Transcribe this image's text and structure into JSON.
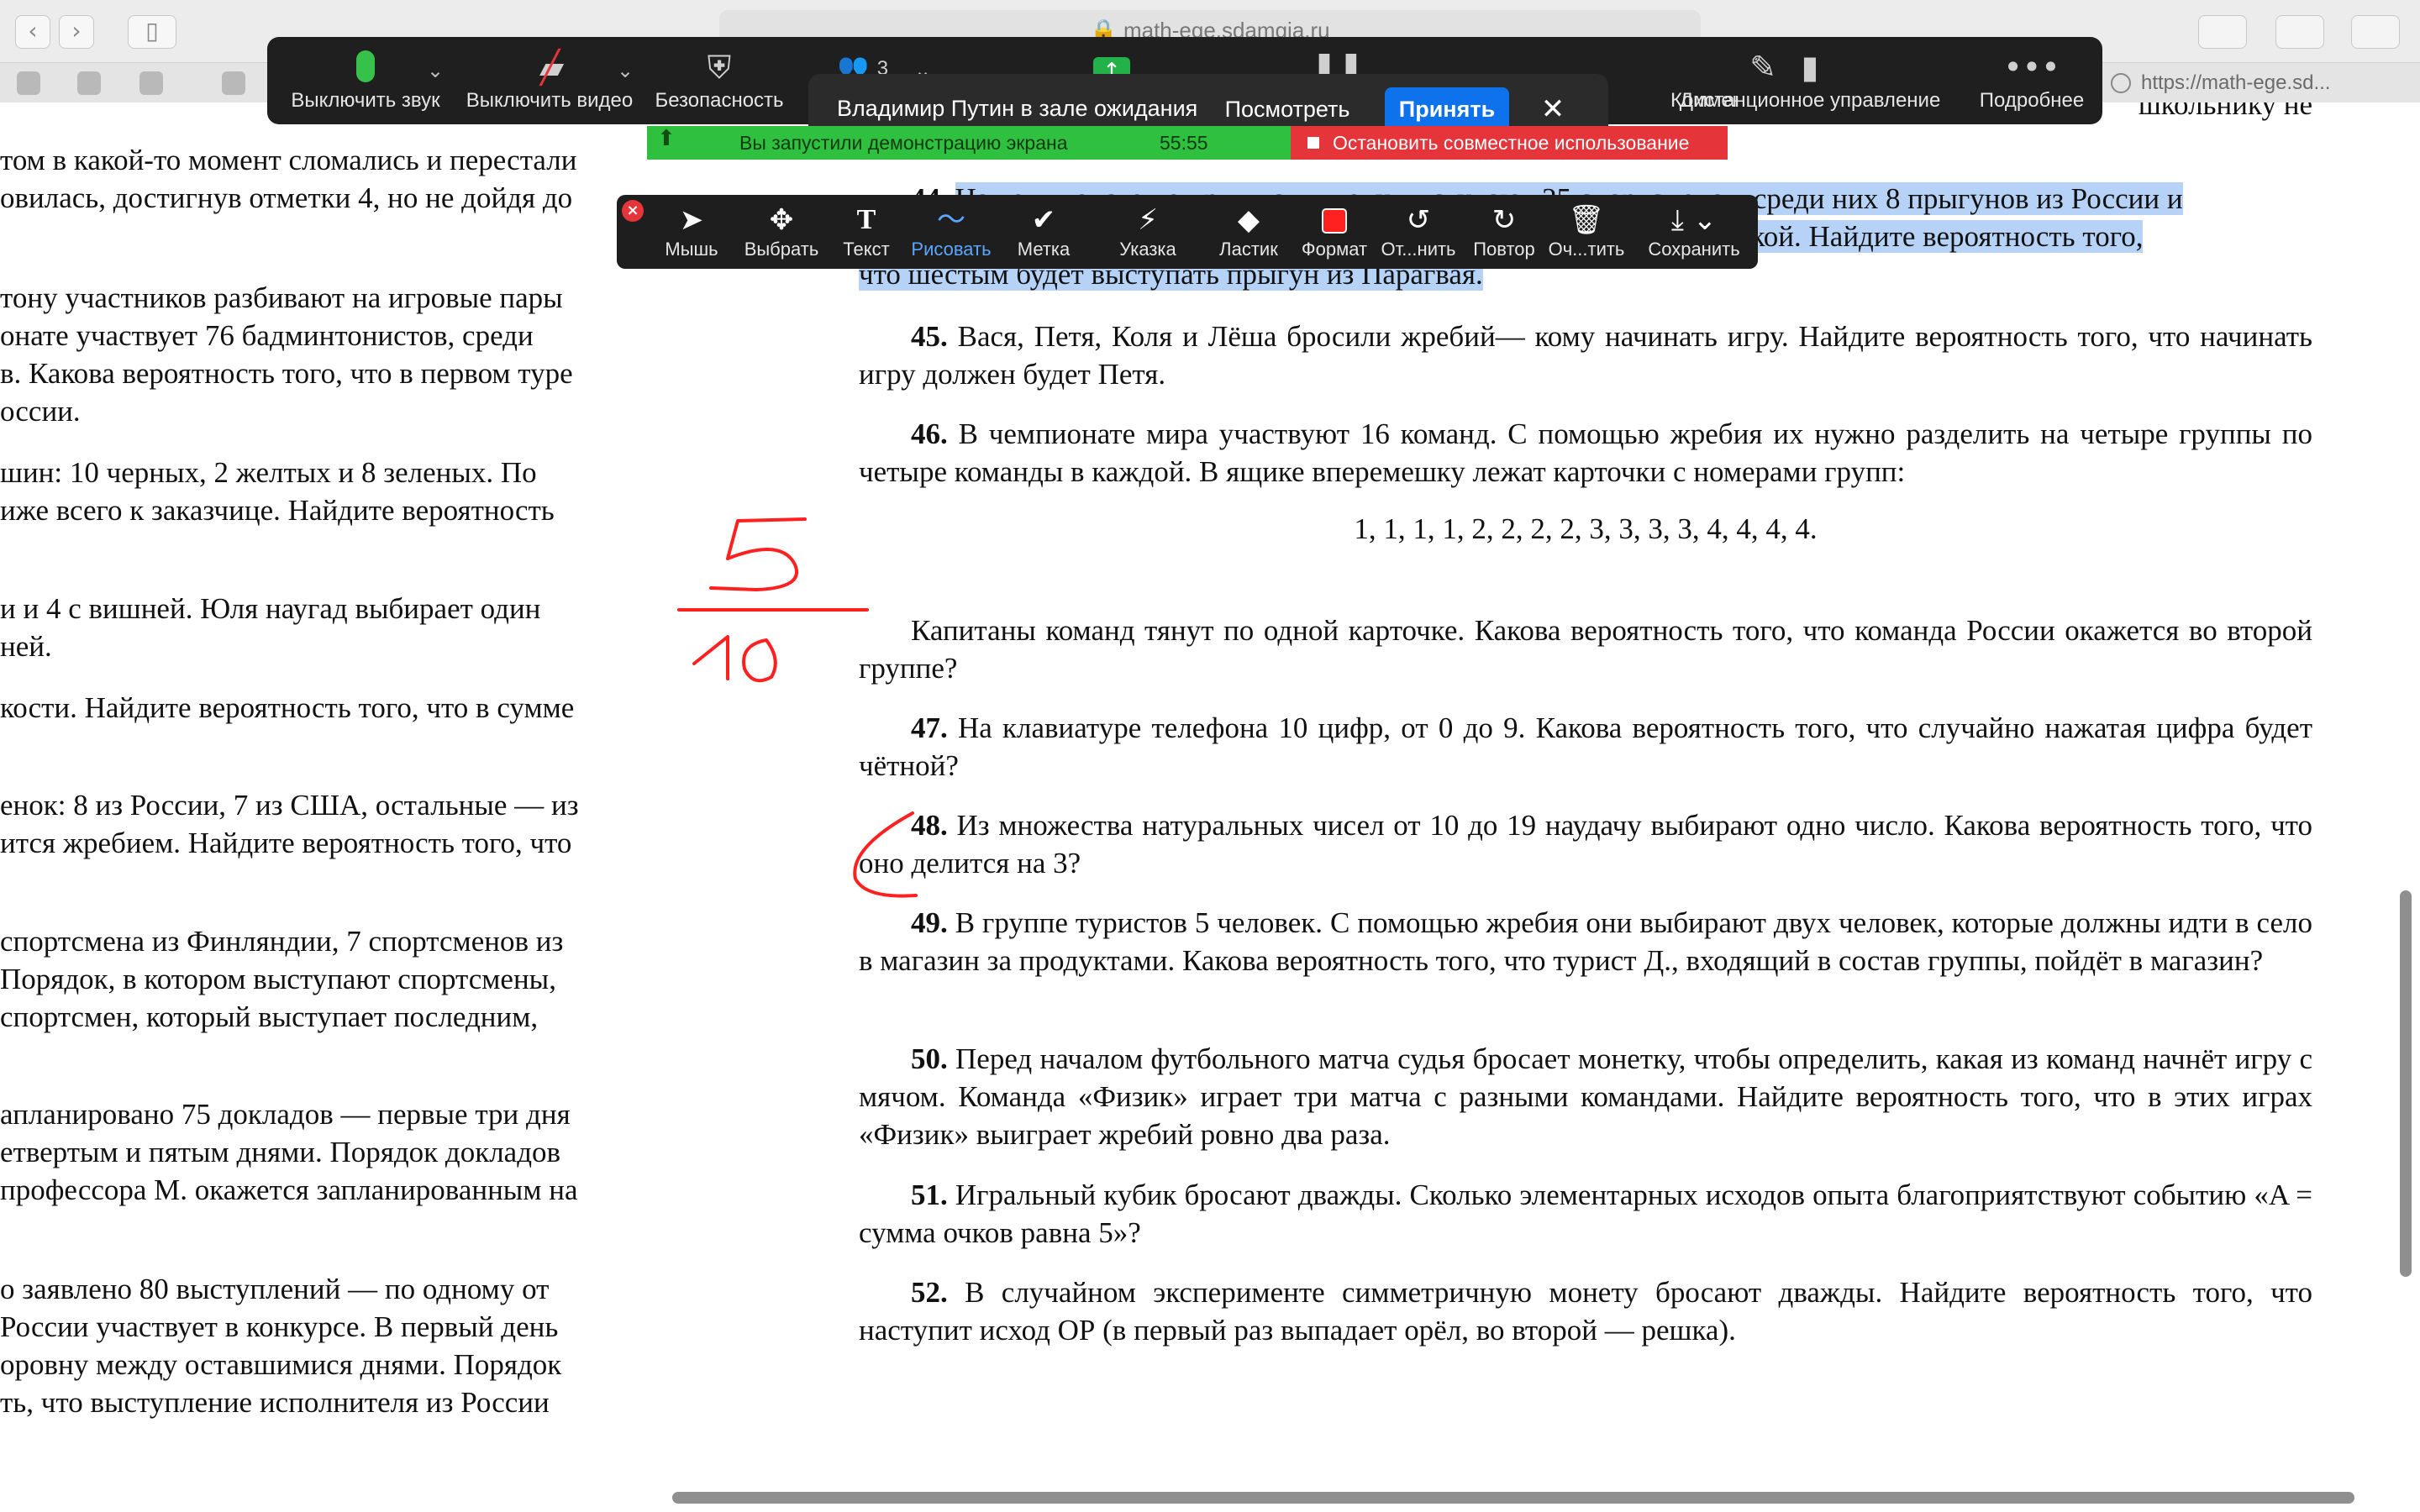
{
  "browser": {
    "url": "math-ege.sdamgia.ru",
    "right_tab": "https://math-ege.sd..."
  },
  "zoom_toolbar": {
    "items": [
      {
        "label": "Выключить звук",
        "icon": "microphone-icon"
      },
      {
        "label": "Выключить видео",
        "icon": "video-off-icon"
      },
      {
        "label": "Безопасность",
        "icon": "shield-icon"
      },
      {
        "label": "3",
        "icon": "participants-icon"
      },
      {
        "label": "Демонстрация",
        "icon": "share-screen-icon"
      },
      {
        "label": "Пауза",
        "icon": "pause-icon"
      },
      {
        "label": "Комментировать",
        "icon": "pencil-icon"
      },
      {
        "label": "Дистанционное управление",
        "icon": "mouse-icon"
      },
      {
        "label": "Подробнее",
        "icon": "more-icon"
      }
    ],
    "participant_count": "3"
  },
  "waiting_room": {
    "message": "Владимир Путин в зале ожидания",
    "view_label": "Посмотреть",
    "accept_label": "Принять"
  },
  "share_status": {
    "message": "Вы запустили демонстрацию экрана",
    "timer": "55:55",
    "stop_label": "Остановить совместное использование"
  },
  "annotation_toolbar": {
    "items": [
      "Мышь",
      "Выбрать",
      "Текст",
      "Рисовать",
      "Метка",
      "Указка",
      "Ластик",
      "Формат",
      "От...нить",
      "Повтор",
      "Оч...тить",
      "Сохранить"
    ],
    "active": "Рисовать",
    "draw_color": "#ff2020"
  },
  "left_column": [
    "том в какой-то момент сломались и перестали",
    "овилась, достигнув отметки 4, но не дойдя до",
    "тону участников разбивают на игровые пары",
    "онате участвует 76 бадминтонистов, среди",
    "в. Какова вероятность того, что в первом туре",
    "оссии.",
    "шин: 10 черных, 2 желтых и 8 зеленых. По",
    "иже всего к заказчице. Найдите вероятность",
    "и и 4 с вишней. Юля наугад выбирает один",
    "ней.",
    "кости. Найдите вероятность того, что в сумме",
    "енок: 8 из России, 7 из США, остальные — из",
    "ится жребием. Найдите вероятность того, что",
    "спортсмена из Финляндии, 7 спортсменов из",
    "Порядок, в котором выступают спортсмены,",
    "спортсмен, который выступает последним,",
    "апланировано 75 докладов — первые три дня",
    "етвертым и пятым днями. Порядок докладов",
    "профессора М. окажется запланированным на",
    "о заявлено 80 выступлений — по одному от",
    "России участвует в конкурсе. В первый день",
    "оровну между оставшимися днями. Порядок",
    "ть, что выступление исполнителя из России"
  ],
  "right_column": {
    "top_partial": "школьнику не",
    "task44": {
      "num": "44.",
      "line1": "На чемпионате по прыжкам в воду выступают 25 спортсменов, среди них 8 прыгунов из России и",
      "line2": "9 прыгунов из Парагвая. Порядок выступлений определяется жеребьёвкой. Найдите вероятность того,",
      "line3": "что шестым будет выступать прыгун из Парагвая."
    },
    "tasks": [
      {
        "num": "45.",
        "text": "Вася, Петя, Коля и Лёша бросили жребий— кому начинать игру. Найдите вероятность того, что начинать игру должен будет Петя."
      },
      {
        "num": "46.",
        "text": "В чемпионате мира участвуют 16 команд. С помощью жребия их нужно разделить на четыре группы по четыре команды в каждой. В ящике вперемешку лежат карточки с номерами групп:"
      },
      {
        "num": "",
        "text": "Капитаны команд тянут по одной карточке. Какова вероятность того, что команда России окажется во второй группе?"
      },
      {
        "num": "47.",
        "text": "На клавиатуре телефона 10 цифр, от 0 до 9. Какова вероятность того, что случайно нажатая цифра будет чётной?"
      },
      {
        "num": "48.",
        "text": "Из множества натуральных чисел от 10 до 19 наудачу выбирают одно число. Какова вероятность того, что оно делится на 3?"
      },
      {
        "num": "49.",
        "text": "В группе туристов 5 человек. С помощью жребия они выбирают двух человек, которые должны идти в село в магазин за продуктами. Какова вероятность того, что турист Д., входящий в состав группы, пойдёт в магазин?"
      },
      {
        "num": "50.",
        "text": "Перед началом футбольного матча судья бросает монетку, чтобы определить, какая из команд начнёт игру с мячом. Команда «Физик» играет три матча с разными командами. Найдите вероятность того, что в этих играх «Физик» выиграет жребий ровно два раза."
      },
      {
        "num": "51.",
        "text": "Игральный кубик бросают дважды. Сколько элементарных исходов опыта благоприятствуют событию «A = сумма очков равна 5»?"
      },
      {
        "num": "52.",
        "text": "В случайном эксперименте симметричную монету бросают дважды. Найдите вероятность того, что наступит исход ОР (в первый раз выпадает орёл, во второй — решка)."
      }
    ],
    "sequence": "1, 1, 1, 1, 2, 2, 2, 2, 3, 3, 3, 3, 4, 4, 4, 4."
  },
  "annotations": {
    "fraction_numerator": "5",
    "fraction_denominator": "10",
    "ink_color": "#ff2020"
  }
}
